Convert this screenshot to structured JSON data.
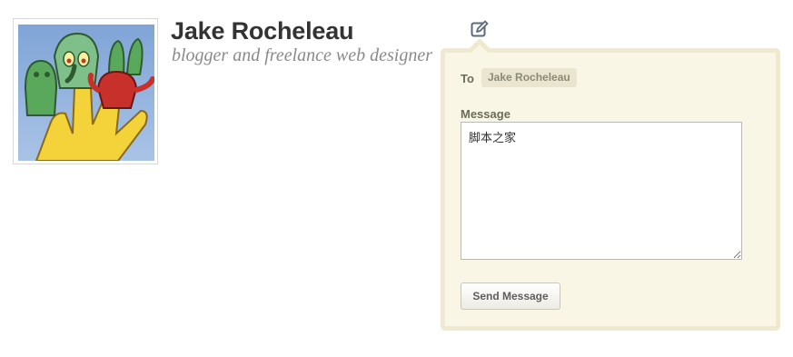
{
  "profile": {
    "name": "Jake Rocheleau",
    "tagline": "blogger and freelance web designer"
  },
  "icons": {
    "compose": "compose-message-icon"
  },
  "message_popup": {
    "to_label": "To",
    "recipient": "Jake Rocheleau",
    "message_label": "Message",
    "message_value": "脚本之家",
    "send_label": "Send Message"
  },
  "colors": {
    "popup_background": "#f9f6e5",
    "popup_border": "#efeacf",
    "name_text": "#333333",
    "tagline_text": "#8a8a8a"
  }
}
